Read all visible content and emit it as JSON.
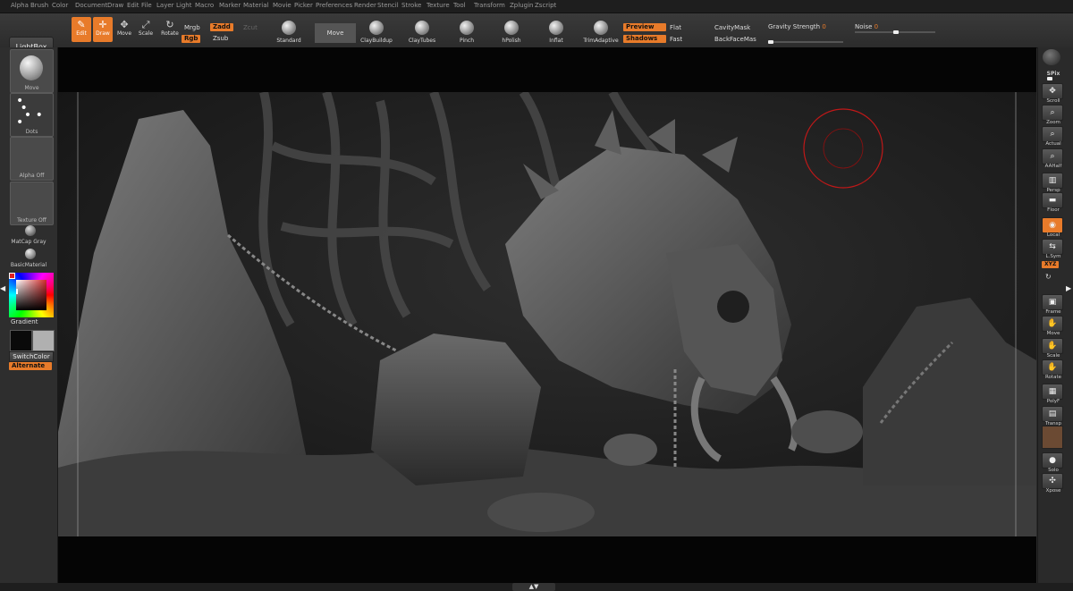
{
  "menu": [
    "Alpha",
    "Brush",
    "Color",
    "Document",
    "Draw",
    "Edit",
    "File",
    "Layer",
    "Light",
    "Macro",
    "Marker",
    "Material",
    "Movie",
    "Picker",
    "Preferences",
    "Render",
    "Stencil",
    "Stroke",
    "Texture",
    "Tool",
    "Transform",
    "Zplugin",
    "Zscript"
  ],
  "lightbox": "LightBox",
  "transform_tools": {
    "edit": "Edit",
    "draw": "Draw",
    "move": "Move",
    "scale": "Scale",
    "rotate": "Rotate"
  },
  "color_modes": {
    "mrgb": "Mrgb",
    "rgb": "Rgb",
    "m": "M",
    "zadd": "Zadd",
    "zsub": "Zsub",
    "zcut": "Zcut"
  },
  "brushes": [
    "Standard",
    "Move",
    "ClayBuildup",
    "ClayTubes",
    "Pinch",
    "hPolish",
    "Inflat",
    "TrimAdaptive"
  ],
  "render_modes": {
    "preview": "Preview",
    "flat": "Flat",
    "shadows": "Shadows",
    "fast": "Fast"
  },
  "cavity_mask": "CavityMask",
  "backface_mask": "BackFaceMas",
  "gravity": {
    "label": "Gravity Strength",
    "value": "0",
    "level": 0
  },
  "noise": {
    "label": "Noise",
    "value": "0",
    "level": 0.05
  },
  "left": {
    "brush_thumb": "Move",
    "stroke_thumb": "Dots",
    "alpha_thumb": "Alpha Off",
    "texture_thumb": "Texture Off",
    "matcap": "MatCap Gray",
    "basic_material": "BasicMaterial",
    "gradient": "Gradient",
    "switch_color": "SwitchColor",
    "alternate": "Alternate"
  },
  "right": {
    "spix": "SPix",
    "scroll": "Scroll",
    "zoom": "Zoom",
    "actual": "Actual",
    "aahalf": "AAHalf",
    "persp": "Persp",
    "floor": "Floor",
    "local": "Local",
    "lsym": "L.Sym",
    "xyz": "XYZ",
    "frame": "Frame",
    "move": "Move",
    "scale": "Scale",
    "rotate": "Rotate",
    "polyf": "PolyF",
    "transp": "Transp",
    "solo": "Solo",
    "xpose": "Xpose"
  },
  "colors": {
    "accent": "#e87b2a",
    "primary_swatch": "#0a0a0a",
    "secondary_swatch": "#b0b0b0",
    "cursor_ring": "#c01818"
  }
}
